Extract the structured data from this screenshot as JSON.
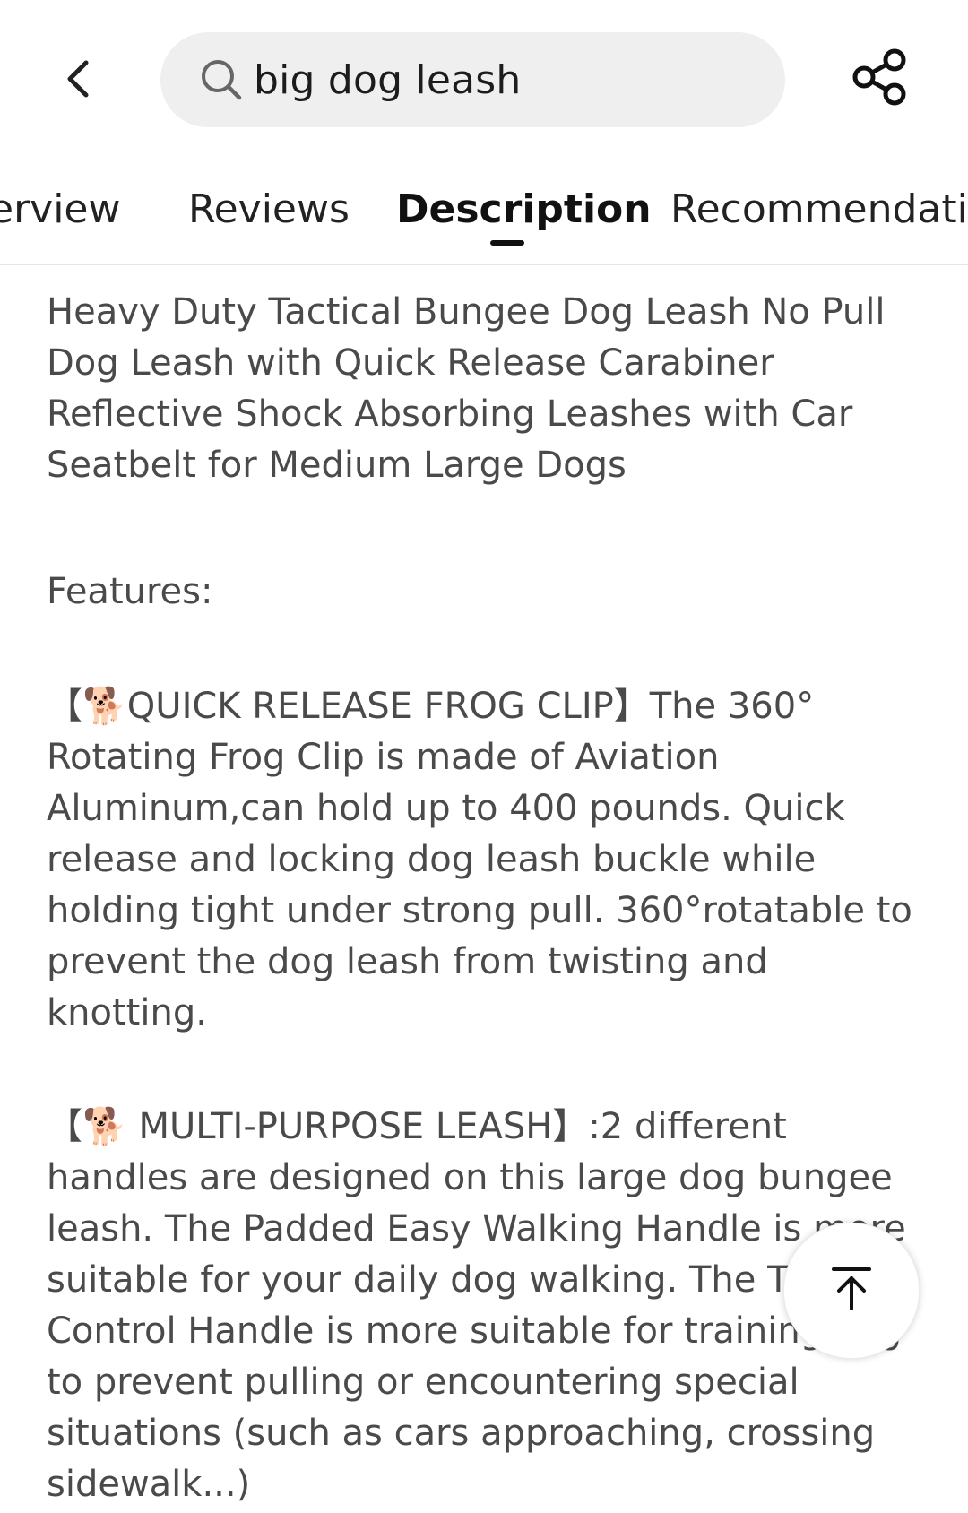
{
  "header": {
    "search_query": "big dog leash",
    "icons": {
      "back": "chevron-left-icon",
      "search": "search-icon",
      "share": "share-icon"
    }
  },
  "tabs": [
    {
      "label": "Overview",
      "visible_text": "erview"
    },
    {
      "label": "Reviews"
    },
    {
      "label": "Description",
      "active": true
    },
    {
      "label": "Recommendati"
    }
  ],
  "description": {
    "title": "Heavy Duty Tactical Bungee Dog Leash No Pull Dog Leash with Quick Release Carabiner Reflective Shock Absorbing Leashes with Car Seatbelt for Medium Large Dogs",
    "features_heading": "Features:",
    "feature_1": " 【🐕QUICK RELEASE FROG CLIP】The 360° Rotating Frog Clip is made of Aviation Aluminum,can hold up to 400 pounds. Quick release and locking dog leash buckle while holding tight under strong pull. 360°rotatable to prevent the dog leash from twisting and knotting.",
    "feature_2": " 【🐕 MULTI-PURPOSE LEASH】:2 different handles are designed on this large dog bungee leash. The Padded Easy Walking Handle is more suitable for your daily dog walking. The Traffic Control Handle is more suitable for training dog to prevent pulling or encountering special situations (such as cars approaching, crossing sidewalk...)"
  },
  "fab": {
    "icon": "arrow-up-to-top-icon"
  }
}
